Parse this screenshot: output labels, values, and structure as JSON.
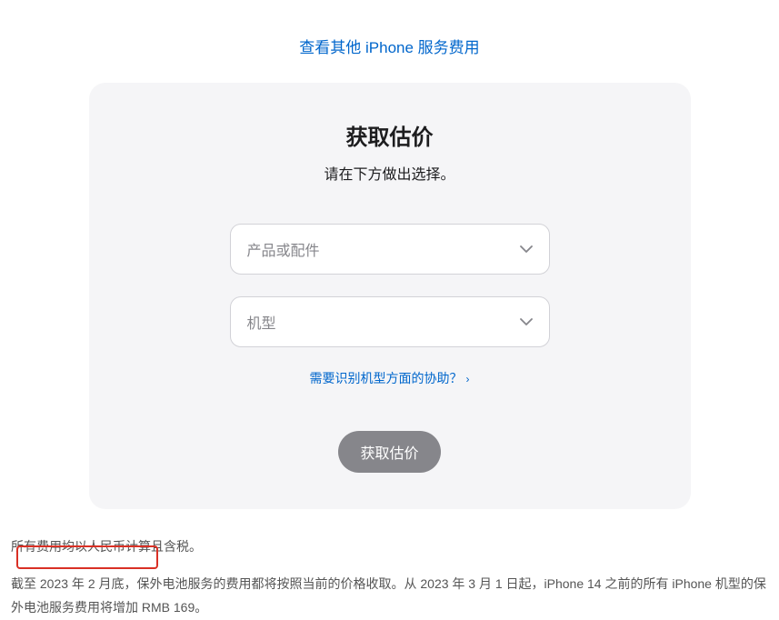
{
  "topLink": "查看其他 iPhone 服务费用",
  "card": {
    "title": "获取估价",
    "subtitle": "请在下方做出选择。",
    "select1": "产品或配件",
    "select2": "机型",
    "helpLink": "需要识别机型方面的协助？",
    "submit": "获取估价"
  },
  "footer": {
    "line1": "所有费用均以人民币计算且含税。",
    "line2": "截至 2023 年 2 月底，保外电池服务的费用都将按照当前的价格收取。从 2023 年 3 月 1 日起，iPhone 14 之前的所有 iPhone 机型的保外电池服务费用将增加 RMB 169。"
  }
}
